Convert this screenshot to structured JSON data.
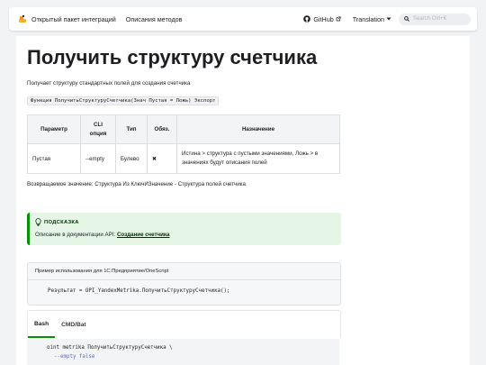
{
  "navbar": {
    "links": [
      "Открытый пакет интеграций",
      "Описания методов"
    ],
    "github_label": "GitHub",
    "translation_label": "Translation",
    "search_placeholder": "Search Ctrl+K"
  },
  "page": {
    "title": "Получить структуру счетчика",
    "description": "Получает структуру стандартных полей для создания счетчика",
    "signature": "Функция ПолучитьСтруктуруСчетчика(Знач Пустая = Ложь) Экспорт",
    "params_table": {
      "headers": [
        "Параметр",
        "CLI опция",
        "Тип",
        "Обяз.",
        "Назначение"
      ],
      "rows": [
        [
          "Пустая",
          "--empty",
          "Булево",
          "✖",
          "Истина > структура с пустыми значениями, Ложь > в значениях будут описания полей"
        ]
      ]
    },
    "return_value": "Возвращаемое значение: Структура Из КлючИЗначение - Структура полей счетчика",
    "tip": {
      "title": "ПОДСКАЗКА",
      "text": "Описание в документации API: ",
      "link": "Создание счетчика"
    },
    "example": {
      "header": "Пример использования для 1С:Предприятие/OneScript",
      "code": "Результат = OPI_YandexMetrika.ПолучитьСтруктуруСчетчика();"
    },
    "cli_tabs": [
      "Bash",
      "CMD/Bat"
    ],
    "cli_code": {
      "line1": "oint metrika ПолучитьСтруктуруСчетчика \\",
      "line2": "--empty false"
    }
  },
  "colors": {
    "accent": "#009400",
    "tip_bg": "#e6f6e6"
  }
}
